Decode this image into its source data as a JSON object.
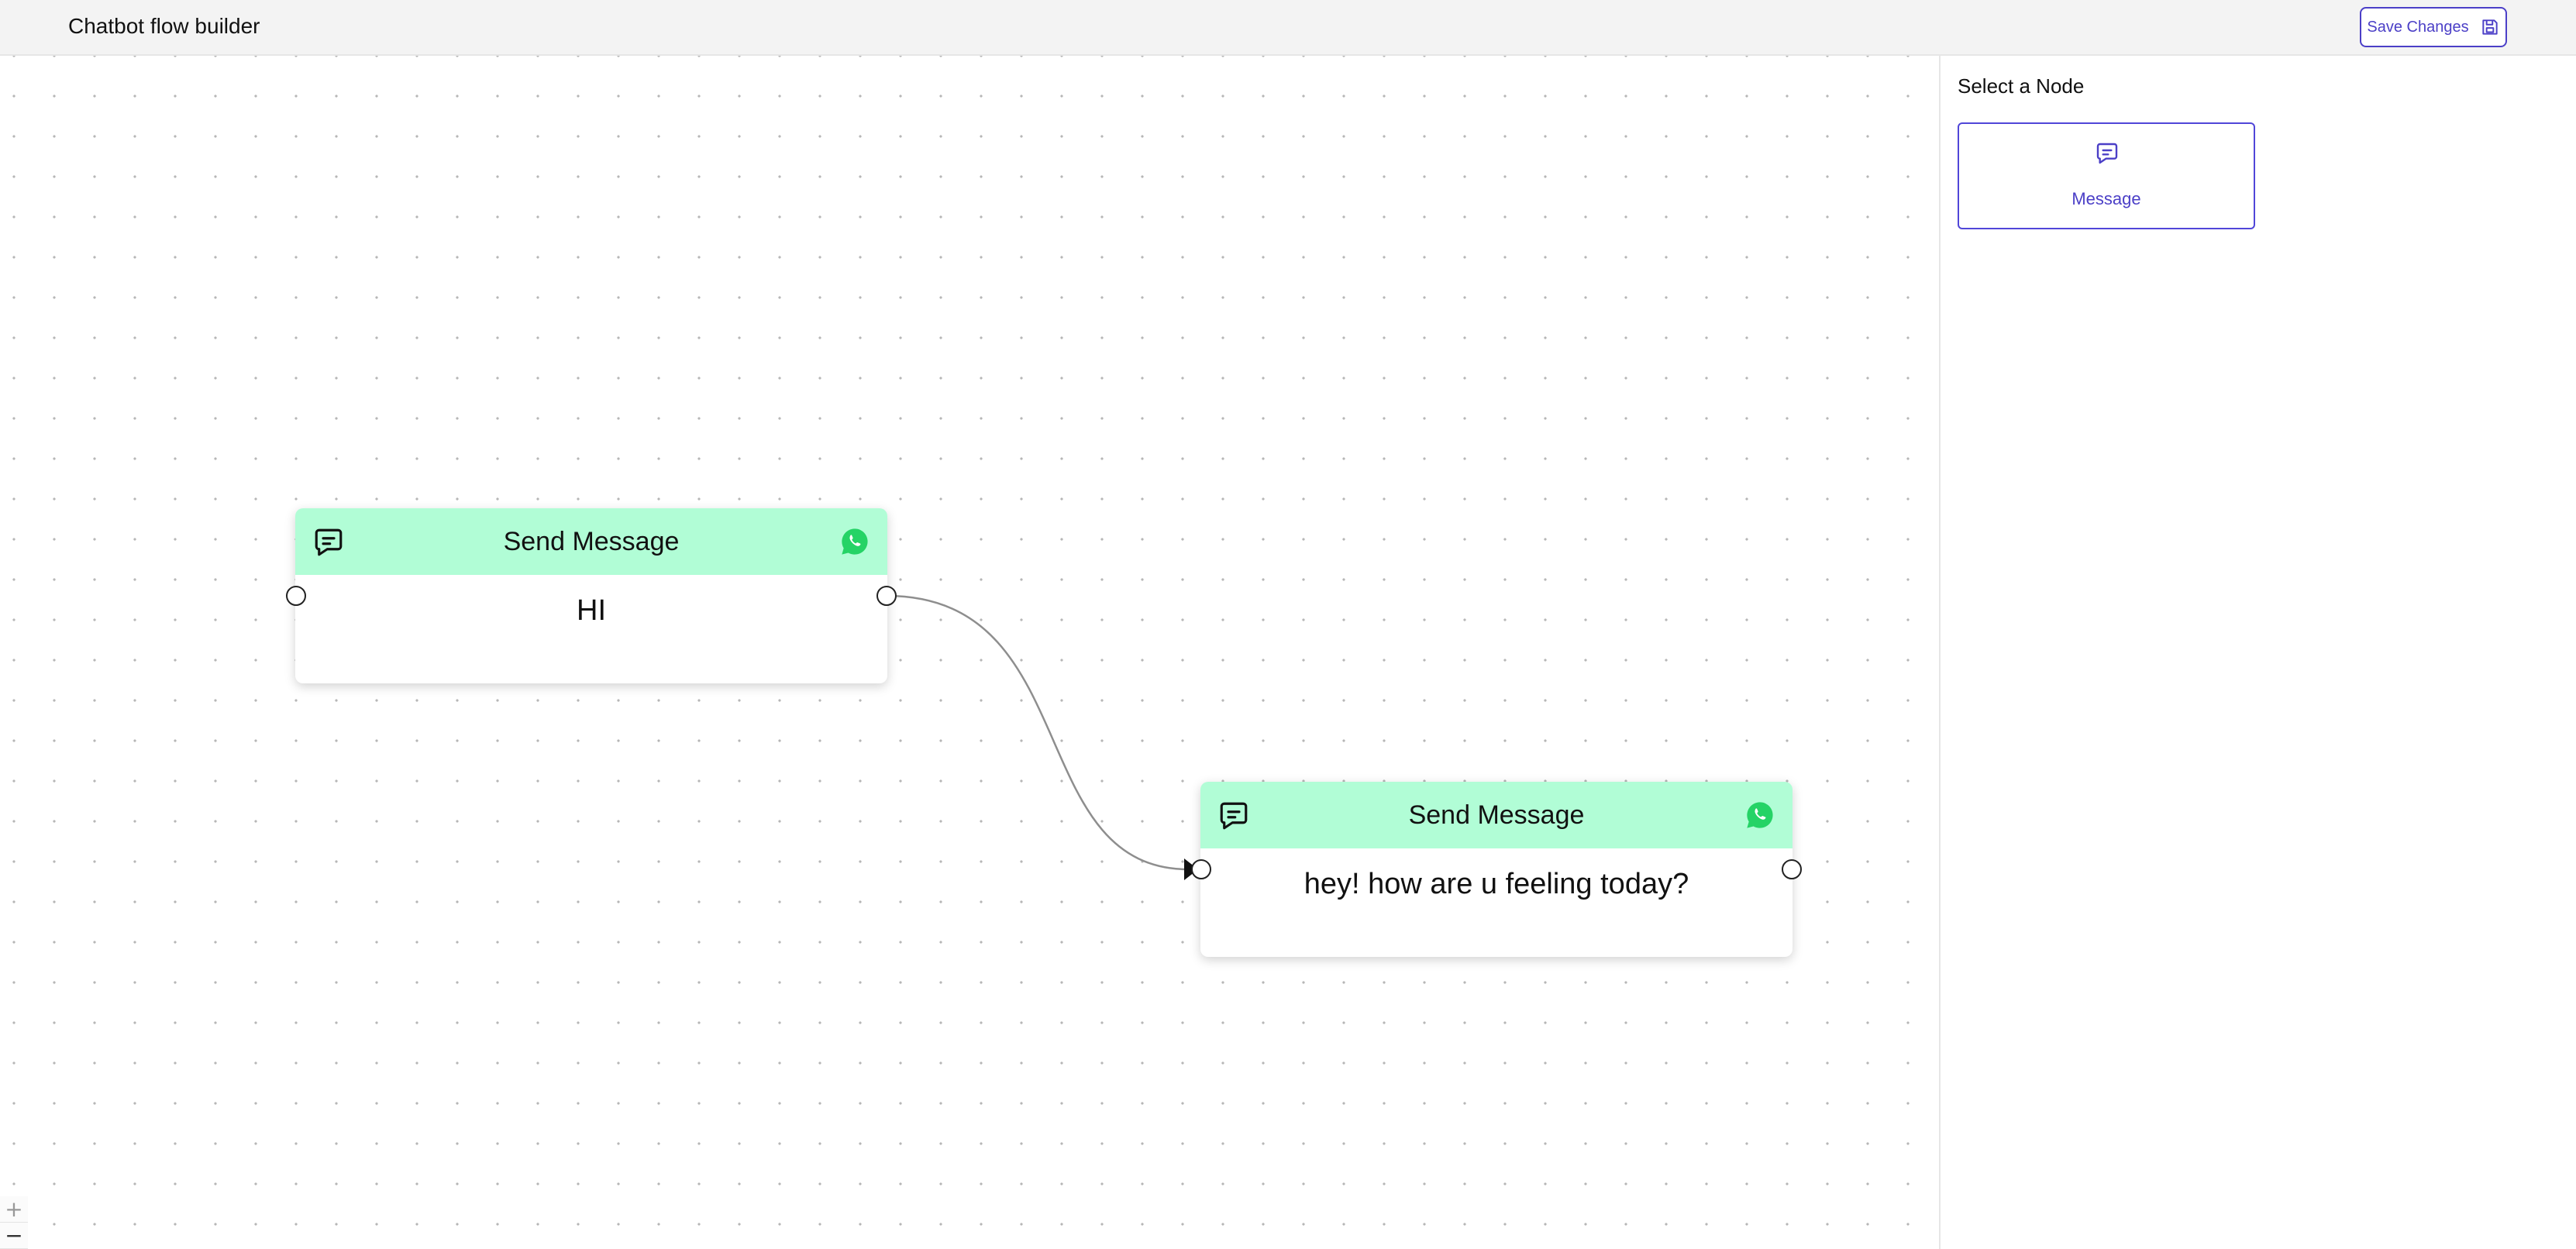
{
  "header": {
    "title": "Chatbot flow builder",
    "save_label": "Save Changes"
  },
  "canvas": {
    "nodes": [
      {
        "title": "Send Message",
        "message": "HI",
        "icon": "message-icon",
        "channel_icon": "whatsapp-icon"
      },
      {
        "title": "Send Message",
        "message": "hey! how are u feeling today?",
        "icon": "message-icon",
        "channel_icon": "whatsapp-icon"
      }
    ],
    "edges": [
      {
        "from": "node 1",
        "to": "node 2"
      }
    ],
    "controls": {
      "zoom_in": "+",
      "zoom_out": "−"
    }
  },
  "panel": {
    "title": "Select a Node",
    "options": [
      {
        "label": "Message",
        "icon": "message-icon"
      }
    ]
  },
  "colors": {
    "node_header": "#b1fdd6",
    "accent": "#4b3fc7",
    "whatsapp": "#25d366",
    "header_bg": "#f3f3f3"
  }
}
